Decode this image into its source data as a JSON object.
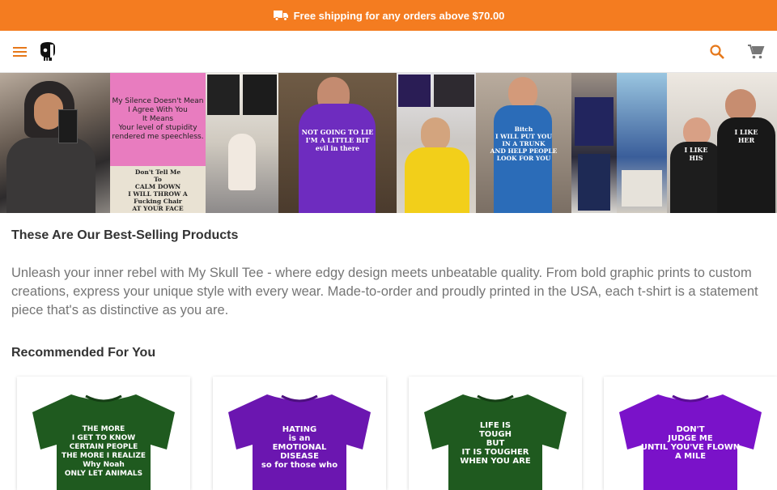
{
  "promo": {
    "text": "Free shipping for any orders above $70.00",
    "icon": "truck-icon"
  },
  "header": {
    "menu_icon": "menu-icon",
    "logo": "skull-logo",
    "search_icon": "search-icon",
    "cart_icon": "cart-icon"
  },
  "banner": {
    "tiles": [
      {
        "caption": ""
      },
      {
        "caption": "My Silence Doesn't Mean\nI Agree With You\nIt Means\nYour level of stupidity\nrendered me speechless."
      },
      {
        "caption": "Don't Tell Me\nTo\nCALM DOWN\nI WILL THROW A\nFucking Chair\nAT YOUR FACE"
      },
      {
        "caption": "NOT GOING TO LIE\nI'M A LITTLE BIT\nevil in there"
      },
      {
        "caption": "Bitch\nI WILL PUT YOU\nIN A TRUNK\nAND HELP PEOPLE\nLOOK FOR YOU"
      },
      {
        "caption": "I LIKE\nHIS"
      },
      {
        "caption": "I LIKE\nHER"
      }
    ]
  },
  "best_selling": {
    "title": "These Are Our Best-Selling Products",
    "description": "Unleash your inner rebel with My Skull Tee - where edgy design meets unbeatable quality. From bold graphic prints to custom creations, express your unique style with every wear. Made-to-order and proudly printed in the USA, each t-shirt is a statement piece that's as distinctive as you are."
  },
  "recommended": {
    "title": "Recommended For You",
    "products": [
      {
        "color": "#1f5a1f",
        "print": "THE MORE\nI GET TO KNOW\nCERTAIN PEOPLE\nTHE MORE I REALIZE\nWhy Noah\nONLY LET ANIMALS"
      },
      {
        "color": "#6b16b0",
        "print": "HATING\nis an\nEMOTIONAL\nDISEASE\nso for those who"
      },
      {
        "color": "#1f5a1f",
        "print": "LIFE IS\nTOUGH\nBUT\nIT IS TOUGHER\nWHEN YOU ARE"
      },
      {
        "color": "#7a12c9",
        "print": "DON'T\nJUDGE ME\nUNTIL YOU'VE FLOWN\nA MILE"
      }
    ]
  },
  "colors": {
    "accent": "#f47c20",
    "text": "#333333",
    "muted": "#757575"
  }
}
